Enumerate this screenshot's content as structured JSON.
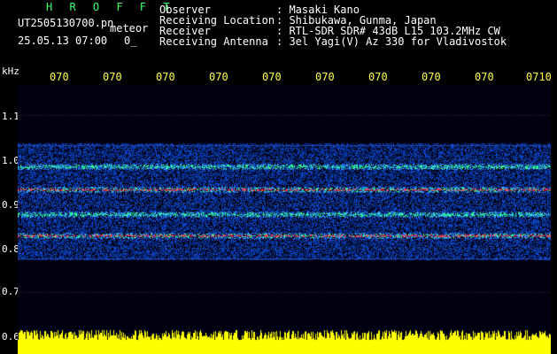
{
  "header": {
    "logo": "H R O F F T",
    "filename": "UT2505130700.pn",
    "mode": "meteor",
    "datetime": "25.05.13 07:00",
    "counter": "0_",
    "fields": [
      {
        "label": "Observer",
        "value": ": Masaki Kano"
      },
      {
        "label": "Receiving Location",
        "value": ": Shibukawa, Gunma, Japan"
      },
      {
        "label": "Receiver",
        "value": ": RTL-SDR SDR# 43dB L15 103.2MHz CW"
      },
      {
        "label": "Receiving Antenna",
        "value": ": 3el Yagi(V) Az 330 for Vladivostok"
      }
    ]
  },
  "axis": {
    "y_unit": "kHz",
    "y_ticks": [
      "1.1",
      "1.0",
      "0.9",
      "0.8",
      "0.7",
      "0.6"
    ],
    "x_ticks": [
      "070",
      "070",
      "070",
      "070",
      "070",
      "070",
      "070",
      "070",
      "070",
      "0710"
    ]
  },
  "colors": {
    "background": "#000000",
    "logo": "#33ff66",
    "time_ticks": "#ffff44",
    "noise": "#1a3fcc",
    "signal_hot": "#ff3344",
    "signal_mid": "#33ff99",
    "audio": "#ffff00"
  }
}
